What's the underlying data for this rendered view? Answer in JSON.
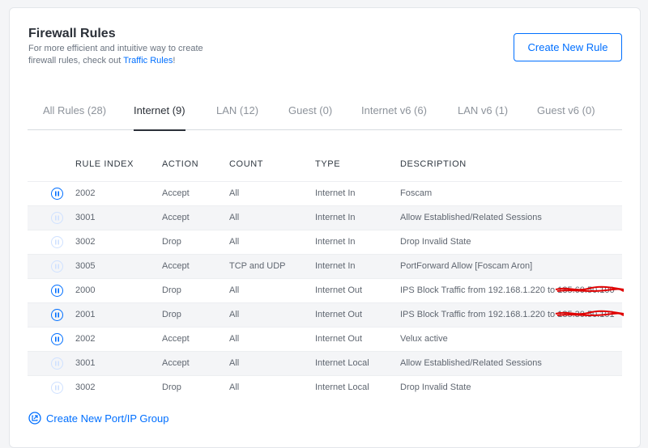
{
  "header": {
    "title": "Firewall Rules",
    "subtitle_text": "For more efficient and intuitive way to create firewall rules, check out ",
    "subtitle_link": "Traffic Rules",
    "subtitle_end": "!",
    "create_button": "Create New Rule"
  },
  "tabs": [
    {
      "label": "All Rules (28)",
      "active": false
    },
    {
      "label": "Internet (9)",
      "active": true
    },
    {
      "label": "LAN (12)",
      "active": false
    },
    {
      "label": "Guest (0)",
      "active": false
    },
    {
      "label": "Internet v6 (6)",
      "active": false
    },
    {
      "label": "LAN v6 (1)",
      "active": false
    },
    {
      "label": "Guest v6 (0)",
      "active": false
    }
  ],
  "columns": [
    "RULE INDEX",
    "ACTION",
    "COUNT",
    "TYPE",
    "DESCRIPTION"
  ],
  "rows": [
    {
      "enabled": true,
      "index": "2002",
      "action": "Accept",
      "count": "All",
      "type": "Internet In",
      "description": "Foscam",
      "redacted": ""
    },
    {
      "enabled": false,
      "index": "3001",
      "action": "Accept",
      "count": "All",
      "type": "Internet In",
      "description": "Allow Established/Related Sessions",
      "redacted": ""
    },
    {
      "enabled": false,
      "index": "3002",
      "action": "Drop",
      "count": "All",
      "type": "Internet In",
      "description": "Drop Invalid State",
      "redacted": ""
    },
    {
      "enabled": false,
      "index": "3005",
      "action": "Accept",
      "count": "TCP and UDP",
      "type": "Internet In",
      "description": "PortForward Allow [Foscam Aron]",
      "redacted": ""
    },
    {
      "enabled": true,
      "index": "2000",
      "action": "Drop",
      "count": "All",
      "type": "Internet Out",
      "description": "IPS Block Traffic from 192.168.1.220 to ",
      "redacted": "185.60.50.100"
    },
    {
      "enabled": true,
      "index": "2001",
      "action": "Drop",
      "count": "All",
      "type": "Internet Out",
      "description": "IPS Block Traffic from 192.168.1.220 to ",
      "redacted": "185.30.50.101"
    },
    {
      "enabled": true,
      "index": "2002",
      "action": "Accept",
      "count": "All",
      "type": "Internet Out",
      "description": "Velux active",
      "redacted": ""
    },
    {
      "enabled": false,
      "index": "3001",
      "action": "Accept",
      "count": "All",
      "type": "Internet Local",
      "description": "Allow Established/Related Sessions",
      "redacted": ""
    },
    {
      "enabled": false,
      "index": "3002",
      "action": "Drop",
      "count": "All",
      "type": "Internet Local",
      "description": "Drop Invalid State",
      "redacted": ""
    }
  ],
  "footer": {
    "group_link": "Create New Port/IP Group",
    "icon": "external-link-icon"
  },
  "colors": {
    "accent": "#006fff",
    "redaction": "#e00000"
  }
}
